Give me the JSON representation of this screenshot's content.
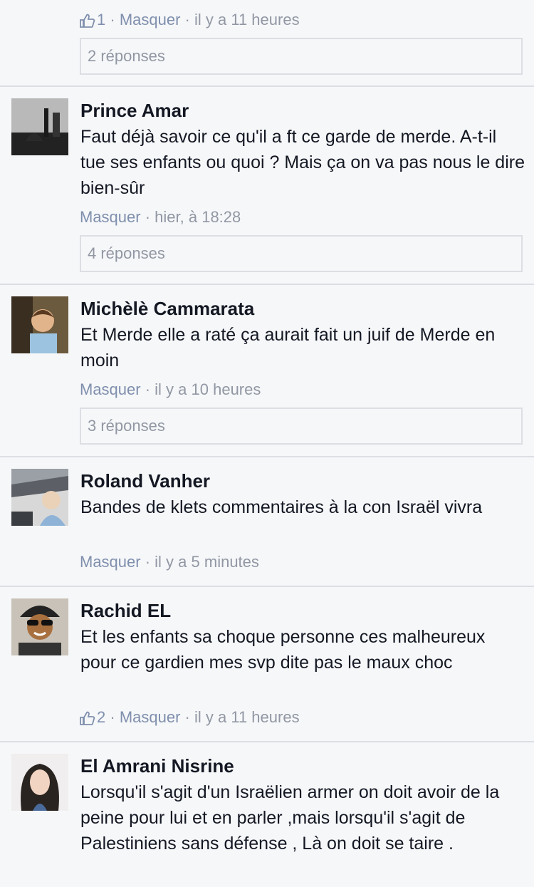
{
  "comments": [
    {
      "meta": {
        "likes": "1",
        "hide": "Masquer",
        "sep": "·",
        "time": "il y a 11 heures"
      },
      "replies": "2 réponses"
    },
    {
      "author": "Prince Amar",
      "text": "Faut déjà savoir ce qu'il a ft ce garde de merde. A-t-il tue ses enfants ou quoi ? Mais ça on va pas nous le dire bien-sûr",
      "meta": {
        "hide": "Masquer",
        "sep": "·",
        "time": "hier, à 18:28"
      },
      "replies": "4 réponses"
    },
    {
      "author": "Michèlè Cammarata",
      "text": "Et Merde elle a raté ça aurait fait un juif de Merde en moin",
      "meta": {
        "hide": "Masquer",
        "sep": "·",
        "time": "il y a 10 heures"
      },
      "replies": "3 réponses"
    },
    {
      "author": "Roland Vanher",
      "text": "Bandes de klets commentaires à la con Israël vivra",
      "meta": {
        "hide": "Masquer",
        "sep": "·",
        "time": "il y a 5 minutes"
      }
    },
    {
      "author": "Rachid EL",
      "text": "Et les enfants sa choque personne ces malheureux pour ce gardien mes svp dite pas le maux choc",
      "meta": {
        "likes": "2",
        "hide": "Masquer",
        "sep": "·",
        "time": "il y a 11 heures"
      }
    },
    {
      "author": "El Amrani Nisrine",
      "text": "Lorsqu'il s'agit d'un Israëlien armer on doit avoir de la peine pour lui et en parler ,mais lorsqu'il s'agit de Palestiniens sans défense , Là on doit se taire ."
    }
  ],
  "colors": {
    "background": "#f6f7f9",
    "link": "#7f8fad",
    "meta": "#9197a3",
    "text": "#141823"
  }
}
